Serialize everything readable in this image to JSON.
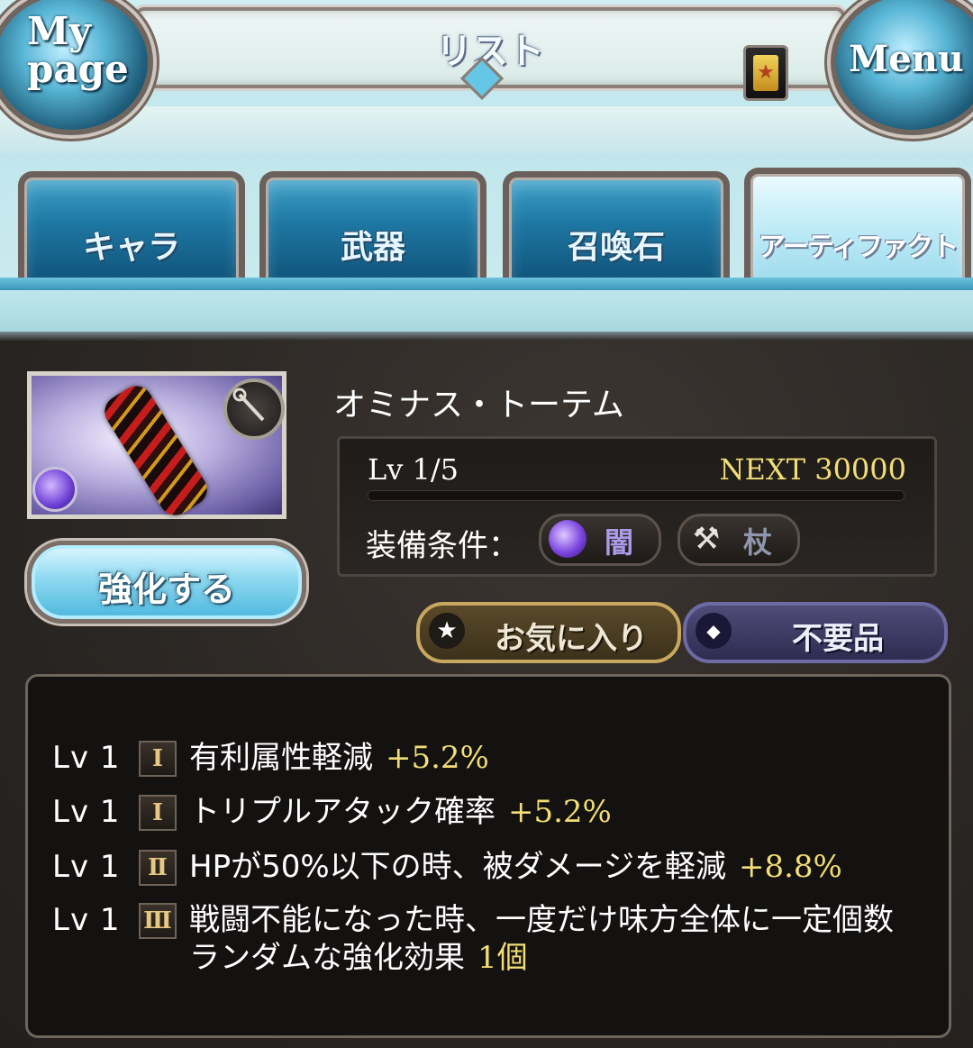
{
  "header": {
    "title": "リスト",
    "mypage_label_line1": "My",
    "mypage_label_line2": "page",
    "menu_label": "Menu"
  },
  "tabs": [
    {
      "label": "キャラ",
      "active": false
    },
    {
      "label": "武器",
      "active": false
    },
    {
      "label": "召喚石",
      "active": false
    },
    {
      "label": "アーティファクト",
      "active": true
    }
  ],
  "item": {
    "name": "オミナス・トーテム",
    "level": "Lv 1/5",
    "next": "NEXT 30000",
    "exp_progress": 0,
    "equip_label": "装備条件：",
    "element": "闇",
    "weapon_type": "杖",
    "upgrade_label": "強化する",
    "favorite_label": "お気に入り",
    "junk_label": "不要品"
  },
  "skills": [
    {
      "lv": "Lv 1",
      "rank": "Ⅰ",
      "text": "有利属性軽減",
      "value": "+5.2%"
    },
    {
      "lv": "Lv 1",
      "rank": "Ⅰ",
      "text": "トリプルアタック確率",
      "value": "+5.2%"
    },
    {
      "lv": "Lv 1",
      "rank": "Ⅱ",
      "text": "HPが50%以下の時、被ダメージを軽減",
      "value": "+8.8%"
    },
    {
      "lv": "Lv 1",
      "rank": "Ⅲ",
      "text": "戦闘不能になった時、一度だけ味方全体に一定個数",
      "text2": "ランダムな強化効果",
      "value": "1個"
    }
  ],
  "colors": {
    "value_gold": "#f2de74",
    "tab_active": "#bdeaf6",
    "tab_inactive": "#1d76a1"
  }
}
